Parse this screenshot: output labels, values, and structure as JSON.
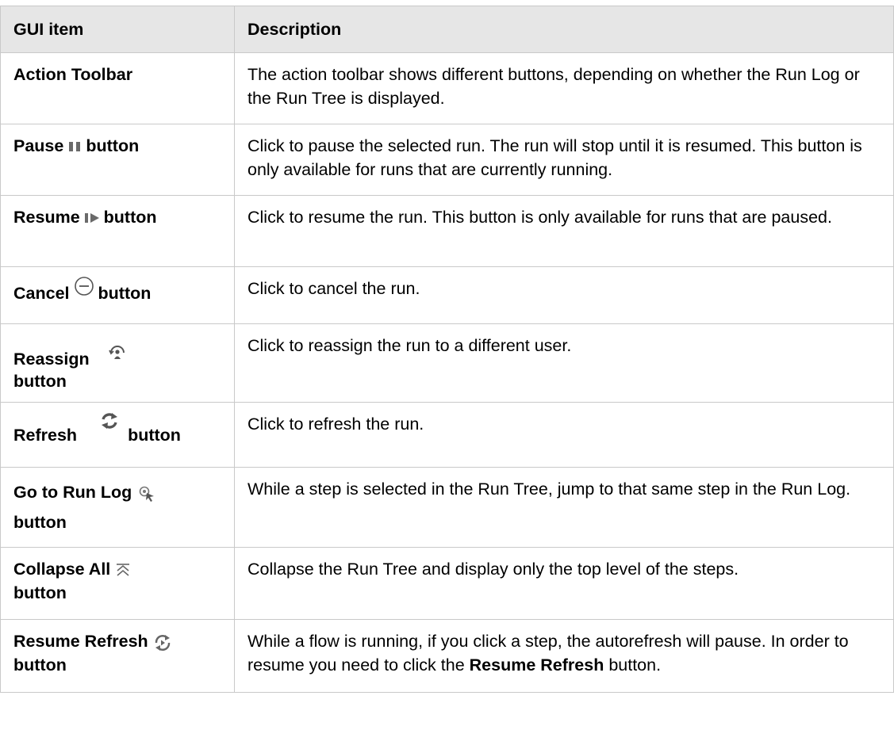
{
  "headers": {
    "item": "GUI item",
    "description": "Description"
  },
  "rows": [
    {
      "item": "Action Toolbar",
      "description": "The action toolbar shows different buttons, depending on whether the Run Log or the Run Tree is displayed."
    },
    {
      "item_name": "Pause",
      "item_suffix": "button",
      "icon": "pause-icon",
      "description": "Click to pause the selected run. The run will stop until it is resumed. This button is only available for runs that are currently running."
    },
    {
      "item_name": "Resume",
      "item_suffix": "button",
      "icon": "resume-icon",
      "description": "Click to resume the run. This button is only available for runs that are paused."
    },
    {
      "item_name": "Cancel",
      "item_suffix": "button",
      "icon": "cancel-icon",
      "description": "Click to cancel the run."
    },
    {
      "item_name": "Reassign",
      "item_suffix": "button",
      "icon": "reassign-icon",
      "description": "Click to reassign the run to a different user."
    },
    {
      "item_name": "Refresh",
      "item_suffix": "button",
      "icon": "refresh-icon",
      "description": "Click to refresh the run."
    },
    {
      "item_name": "Go to Run Log",
      "item_suffix": "button",
      "icon": "go-to-run-log-icon",
      "description": "While a step is selected in the Run Tree, jump to that same step in the Run Log."
    },
    {
      "item_name": "Collapse All",
      "item_suffix": "button",
      "icon": "collapse-all-icon",
      "description": "Collapse the Run Tree and display only the top level of the steps."
    },
    {
      "item_name": "Resume Refresh",
      "item_suffix": "button",
      "icon": "resume-refresh-icon",
      "description_before": "While a flow is running, if you click a step, the autorefresh will pause. In order to resume you need to click the ",
      "description_bold": "Resume Refresh",
      "description_after": " button."
    }
  ]
}
